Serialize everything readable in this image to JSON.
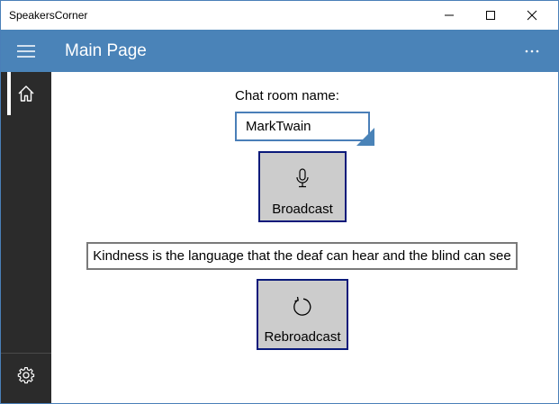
{
  "window": {
    "title": "SpeakersCorner"
  },
  "appbar": {
    "title": "Main Page",
    "menu_icon": "hamburger-icon",
    "more_icon": "more-icon",
    "accent_color": "#4a83b8"
  },
  "sidebar": {
    "items": [
      {
        "icon": "home-icon",
        "selected": true
      },
      {
        "icon": "gear-icon",
        "selected": false
      }
    ],
    "background": "#2b2b2b"
  },
  "main": {
    "chat_room_label": "Chat room name:",
    "chat_room_value": "MarkTwain",
    "broadcast_label": "Broadcast",
    "broadcast_icon": "microphone-icon",
    "quote_text": "Kindness is the language that the deaf can hear and the blind can see",
    "rebroadcast_label": "Rebroadcast",
    "rebroadcast_icon": "refresh-icon"
  }
}
